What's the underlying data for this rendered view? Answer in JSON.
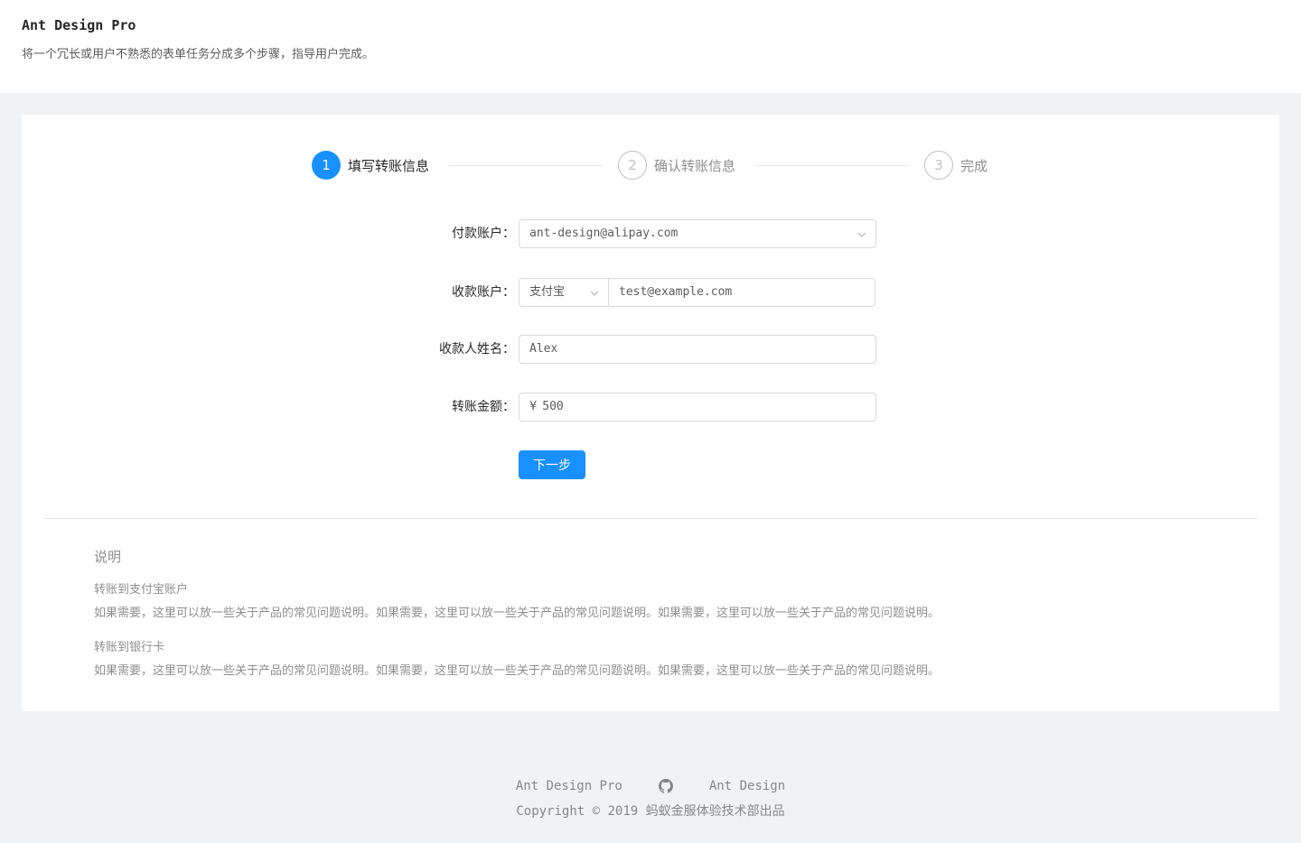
{
  "header": {
    "title": "Ant Design Pro",
    "description": "将一个冗长或用户不熟悉的表单任务分成多个步骤，指导用户完成。"
  },
  "steps": [
    {
      "number": "1",
      "title": "填写转账信息",
      "status": "active"
    },
    {
      "number": "2",
      "title": "确认转账信息",
      "status": "wait"
    },
    {
      "number": "3",
      "title": "完成",
      "status": "wait"
    }
  ],
  "form": {
    "payer": {
      "label": "付款账户：",
      "value": "ant-design@alipay.com"
    },
    "receiver": {
      "label": "收款账户：",
      "type": "支付宝",
      "value": "test@example.com"
    },
    "receiver_name": {
      "label": "收款人姓名：",
      "value": "Alex"
    },
    "amount": {
      "label": "转账金额：",
      "prefix": "¥",
      "value": "500"
    },
    "submit_label": "下一步"
  },
  "description": {
    "title": "说明",
    "sections": [
      {
        "heading": "转账到支付宝账户",
        "text": "如果需要，这里可以放一些关于产品的常见问题说明。如果需要，这里可以放一些关于产品的常见问题说明。如果需要，这里可以放一些关于产品的常见问题说明。"
      },
      {
        "heading": "转账到银行卡",
        "text": "如果需要，这里可以放一些关于产品的常见问题说明。如果需要，这里可以放一些关于产品的常见问题说明。如果需要，这里可以放一些关于产品的常见问题说明。"
      }
    ]
  },
  "footer": {
    "links": [
      "Ant Design Pro",
      "github-icon",
      "Ant Design"
    ],
    "link_pro": "Ant Design Pro",
    "link_ant": "Ant Design",
    "copyright": "Copyright © 2019 蚂蚁金服体验技术部出品"
  },
  "colors": {
    "primary": "#1890ff",
    "background": "#f0f2f5"
  }
}
